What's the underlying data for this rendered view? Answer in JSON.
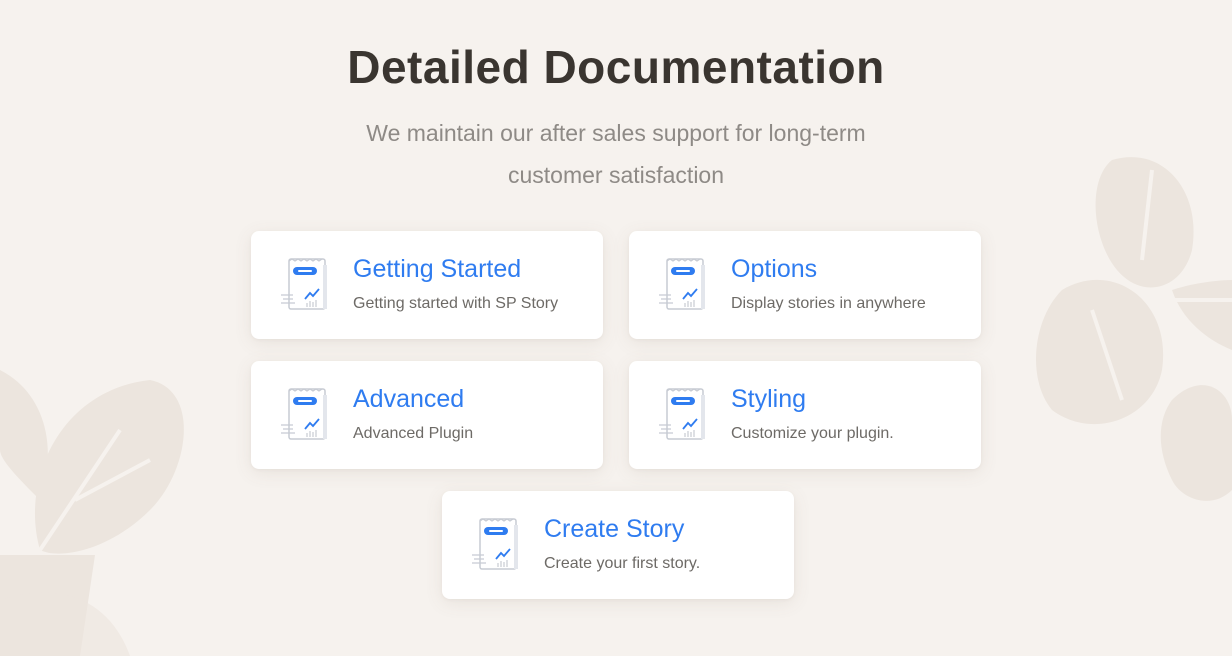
{
  "section": {
    "title": "Detailed Documentation",
    "subtitle_line1": "We maintain our after sales support for long-term",
    "subtitle_line2": "customer satisfaction"
  },
  "cards": [
    {
      "title": "Getting Started",
      "description": "Getting started with SP Story",
      "icon": "document-chart-icon"
    },
    {
      "title": "Options",
      "description": "Display stories in anywhere",
      "icon": "document-chart-icon"
    },
    {
      "title": "Advanced",
      "description": "Advanced Plugin",
      "icon": "document-chart-icon"
    },
    {
      "title": "Styling",
      "description": "Customize your plugin.",
      "icon": "document-chart-icon"
    },
    {
      "title": "Create Story",
      "description": "Create your first story.",
      "icon": "document-chart-icon"
    }
  ],
  "colors": {
    "background": "#f6f2ee",
    "accent": "#2f7cf0",
    "heading": "#3a3530",
    "decor_leaf": "#ece5de"
  }
}
